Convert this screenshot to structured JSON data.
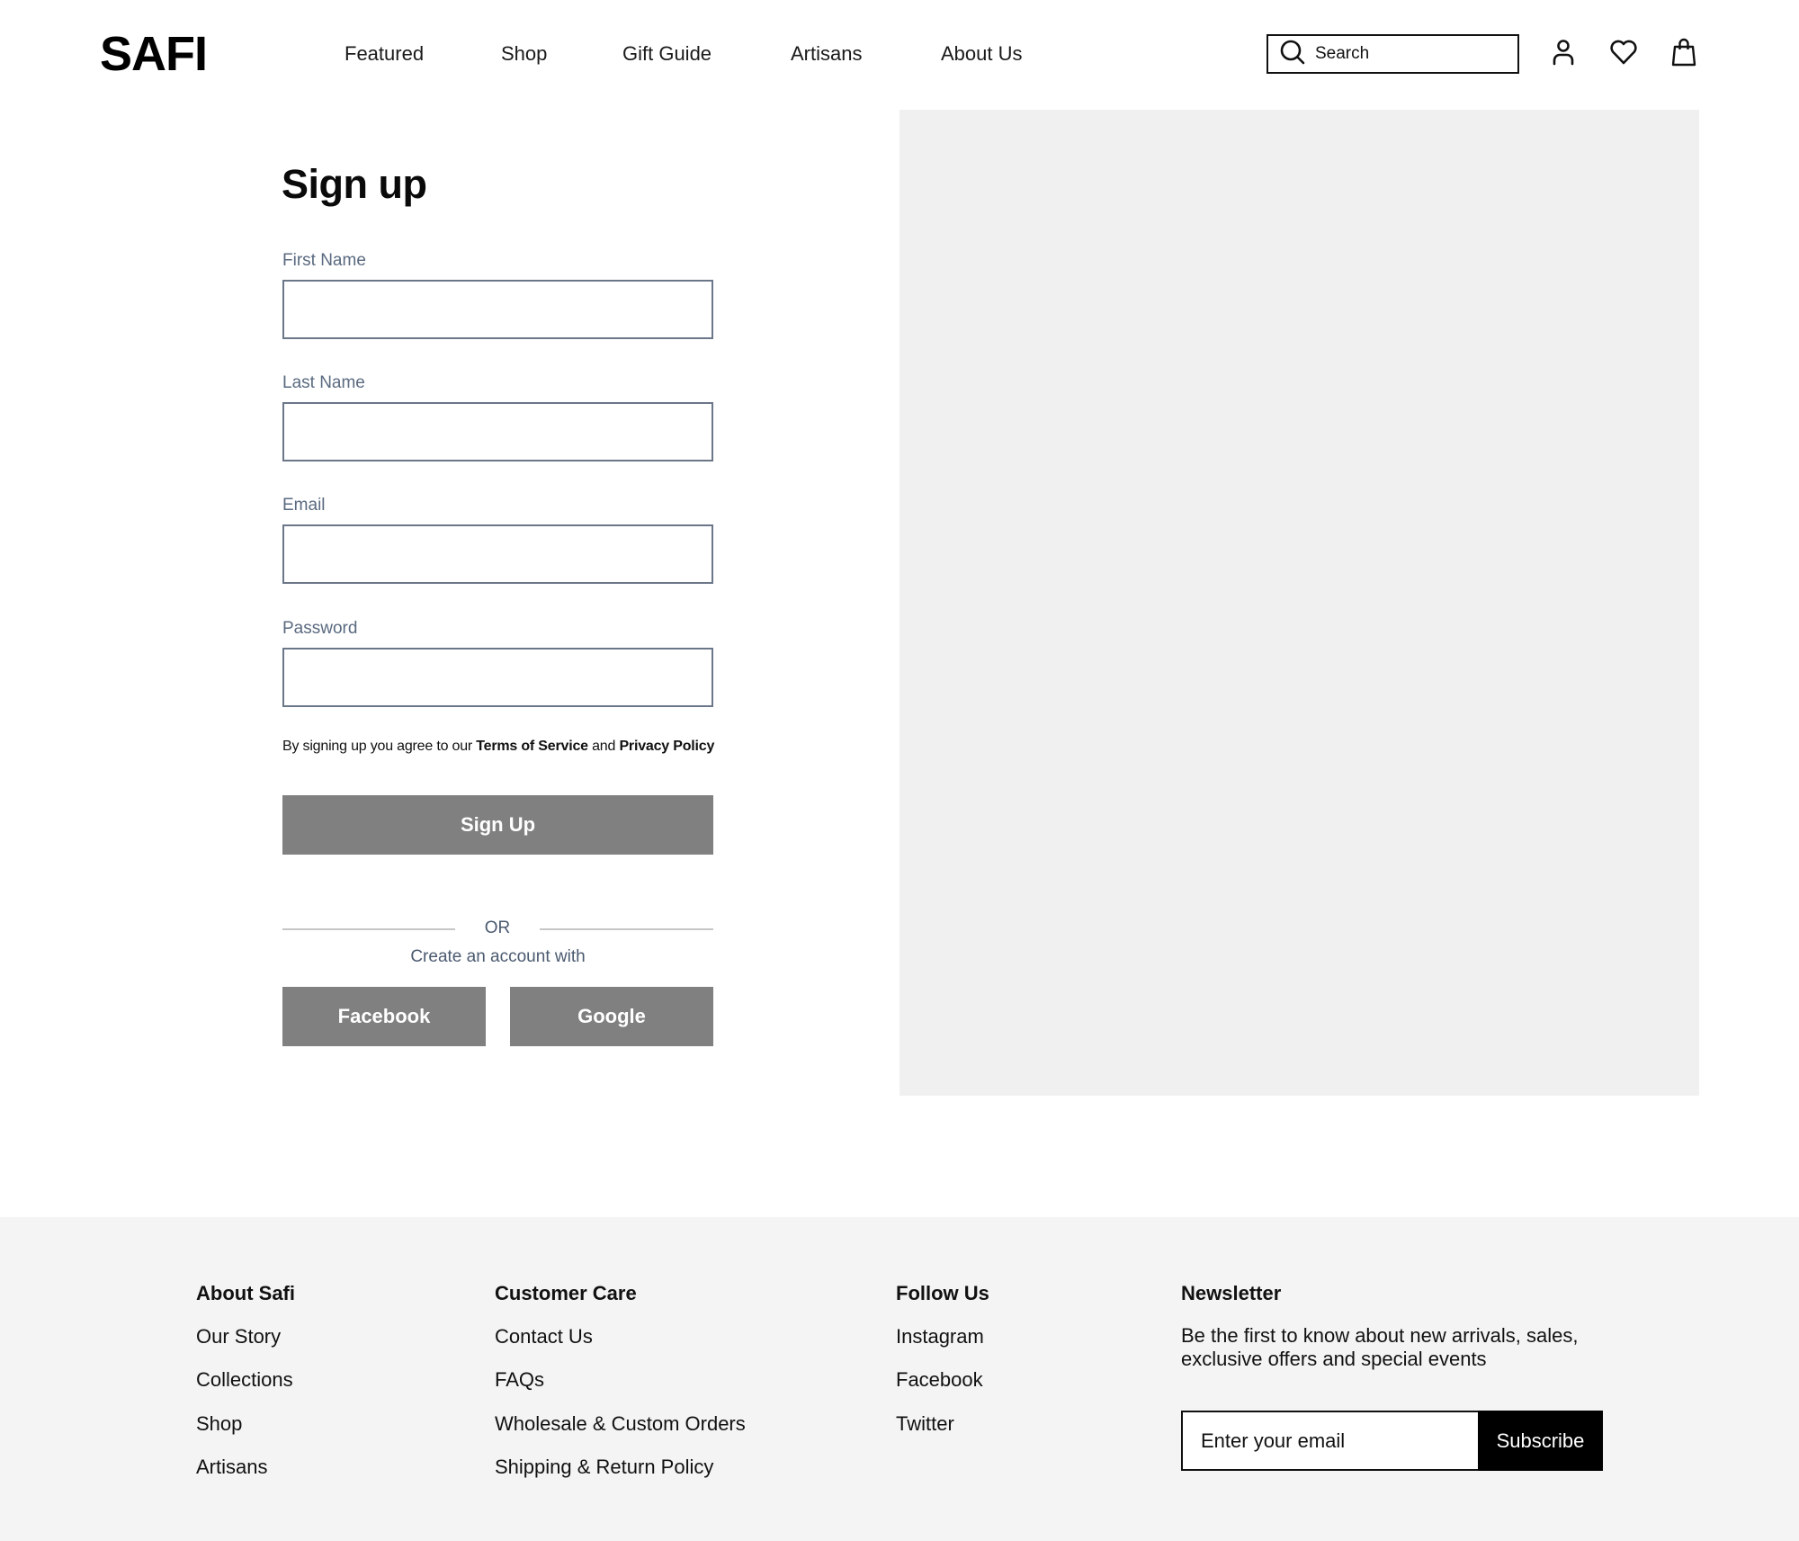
{
  "header": {
    "logo": "SAFI",
    "nav": [
      {
        "label": "Featured"
      },
      {
        "label": "Shop"
      },
      {
        "label": "Gift Guide"
      },
      {
        "label": "Artisans"
      },
      {
        "label": "About Us"
      }
    ],
    "search": {
      "placeholder": "Search",
      "icon": "search-icon"
    },
    "icons": [
      "user-icon",
      "heart-icon",
      "shopping-bag-icon"
    ]
  },
  "signup": {
    "title": "Sign up",
    "fields": [
      {
        "label": "First Name",
        "value": ""
      },
      {
        "label": "Last Name",
        "value": ""
      },
      {
        "label": "Email",
        "value": ""
      },
      {
        "label": "Password",
        "value": ""
      }
    ],
    "terms": {
      "prefix": "By signing up you agree to our ",
      "tos": "Terms of Service",
      "and": " and ",
      "privacy": "Privacy Policy"
    },
    "submit_label": "Sign Up",
    "divider_text": "OR",
    "social_prompt": "Create an account with",
    "social_buttons": [
      {
        "label": "Facebook"
      },
      {
        "label": "Google"
      }
    ]
  },
  "colors": {
    "button_gray": "#808080",
    "image_placeholder": "#f0f0f0",
    "footer_bg": "#f4f4f4",
    "label_slate": "#5a6a80"
  },
  "footer": {
    "columns": [
      {
        "heading": "About Safi",
        "links": [
          "Our Story",
          "Collections",
          "Shop",
          "Artisans"
        ]
      },
      {
        "heading": "Customer Care",
        "links": [
          "Contact Us",
          "FAQs",
          "Wholesale & Custom Orders",
          "Shipping & Return Policy"
        ]
      },
      {
        "heading": "Follow Us",
        "links": [
          "Instagram",
          "Facebook",
          "Twitter"
        ]
      }
    ],
    "newsletter": {
      "heading": "Newsletter",
      "text": "Be the first to know about new arrivals, sales, exclusive offers and special events",
      "placeholder": "Enter your email",
      "button_label": "Subscribe"
    }
  }
}
